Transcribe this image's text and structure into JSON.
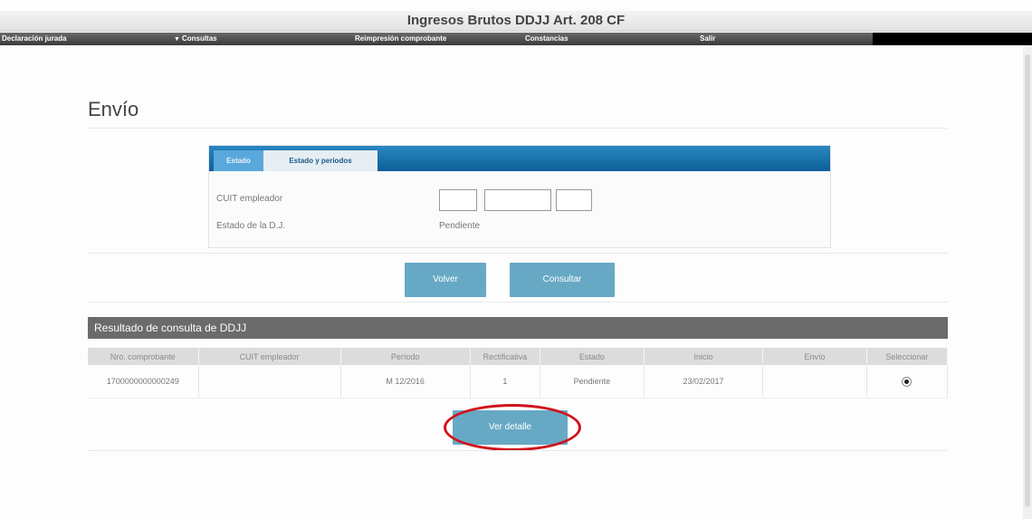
{
  "window": {
    "title": "Ingresos Brutos DDJJ Art. 208 CF"
  },
  "menu": {
    "items": [
      {
        "label": "Declaración jurada",
        "dropdown": false
      },
      {
        "label": "Consultas",
        "dropdown": true
      },
      {
        "label": "Reimpresión comprobante",
        "dropdown": false
      },
      {
        "label": "Constancias",
        "dropdown": false
      },
      {
        "label": "Salir",
        "dropdown": false
      }
    ]
  },
  "page": {
    "title": "Envío"
  },
  "tabs": [
    {
      "label": "Estado",
      "active": true
    },
    {
      "label": "Estado y períodos",
      "active": false
    }
  ],
  "form": {
    "cuit_label": "CUIT empleador",
    "cuit_part1": "",
    "cuit_part2": "",
    "cuit_part3": "",
    "estado_label": "Estado de la D.J.",
    "estado_value": "Pendiente"
  },
  "buttons": {
    "volver": "Volver",
    "consultar": "Consultar",
    "ver_detalle": "Ver detalle"
  },
  "results": {
    "title": "Resultado de consulta de DDJJ",
    "columns": [
      "Nro. comprobante",
      "CUIT empleador",
      "Período",
      "Rectificativa",
      "Estado",
      "Inicio",
      "Envío",
      "Seleccionar"
    ],
    "rows": [
      {
        "nro": "1700000000000249",
        "cuit": "",
        "periodo": "M 12/2016",
        "rectificativa": "1",
        "estado": "Pendiente",
        "inicio": "23/02/2017",
        "envio": "",
        "selected": true
      }
    ]
  },
  "colors": {
    "button": "#67a9c5",
    "tab_bar": "#1a70a8",
    "results_header": "#6b6b6b",
    "highlight": "#d0121b"
  }
}
